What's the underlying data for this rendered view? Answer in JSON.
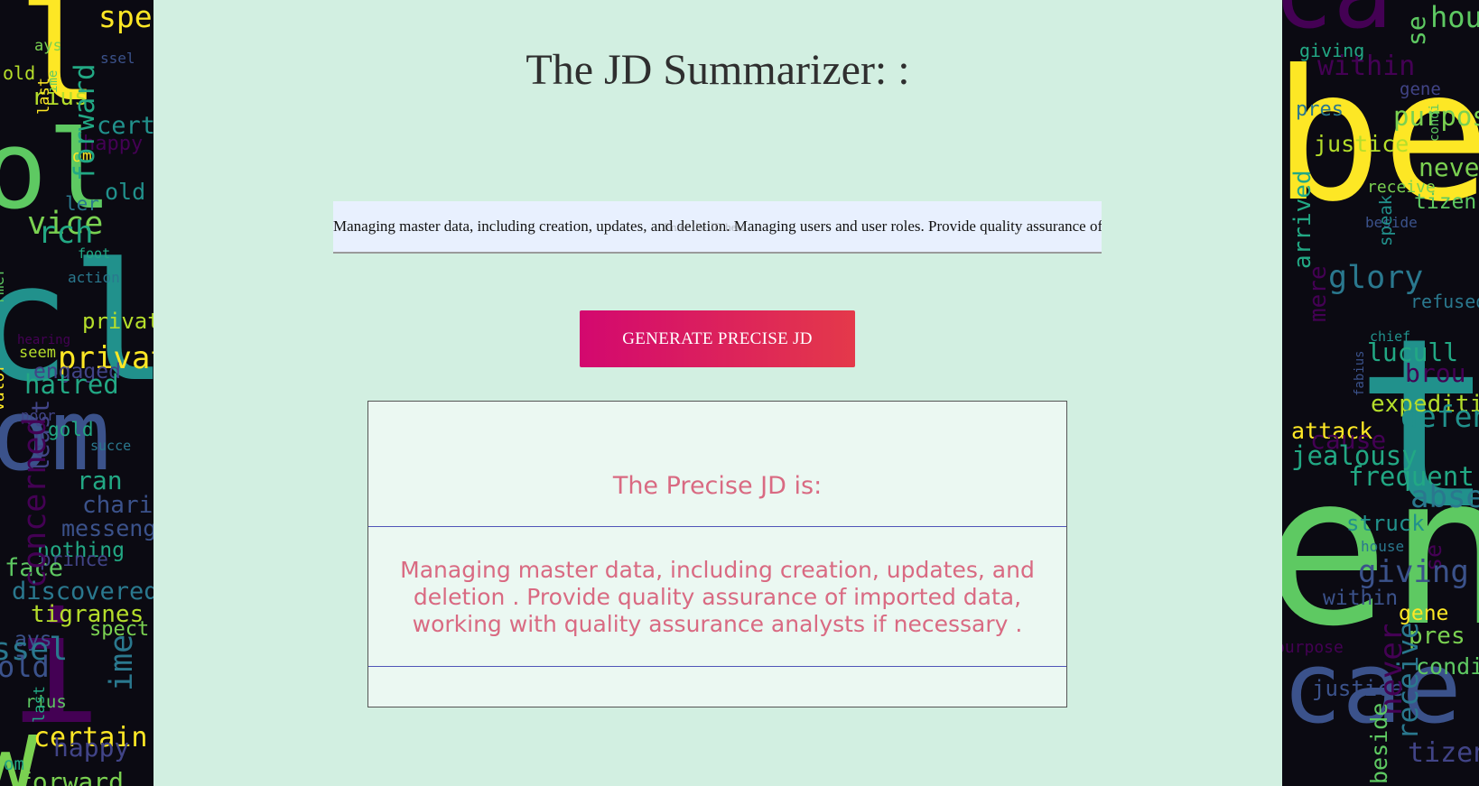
{
  "page": {
    "title": "The JD Summarizer: :"
  },
  "input": {
    "value": "Managing master data, including creation, updates, and deletion. Managing users and user roles. Provide quality assurance of imported data, working with quality assurance analysts if necessary.",
    "ghost_label": "Enter the JD here"
  },
  "button": {
    "label": "GENERATE PRECISE JD"
  },
  "result": {
    "heading": "The Precise JD is:",
    "text": "Managing master data, including creation, updates, and deletion . Provide quality assurance of imported data, working with quality assurance analysts if necessary ."
  },
  "decor": {
    "left_words": [
      "spect",
      "ays",
      "ssel",
      "old",
      "ime",
      "rius",
      "last",
      "certain",
      "happy",
      "om",
      "forward",
      "old",
      "ler",
      "vice",
      "rch",
      "foot",
      "action",
      "rmer",
      "private",
      "hearing",
      "seem",
      "privately",
      "engaged",
      "hatred",
      "valor",
      "poor",
      "gold",
      "succe",
      "least",
      "ran",
      "chariot",
      "messenger",
      "nothing",
      "prince",
      "face",
      "concerned",
      "discovered",
      "tigranes"
    ],
    "right_words": [
      "house",
      "se",
      "giving",
      "within",
      "gene",
      "pres",
      "purpose",
      "condi",
      "justice",
      "never",
      "receive",
      "tizen",
      "beside",
      "speak",
      "arrived",
      "glory",
      "refused",
      "mere",
      "chief",
      "lucull",
      "brou",
      "fabius",
      "expedition",
      "defense",
      "attack",
      "cause",
      "jealousy",
      "frequent",
      "absence",
      "struck"
    ],
    "colors": [
      "#fde725",
      "#5ec962",
      "#21918c",
      "#3b528b",
      "#440154",
      "#7ad151",
      "#2a788e",
      "#b5de2b",
      "#22a884",
      "#414487"
    ]
  }
}
